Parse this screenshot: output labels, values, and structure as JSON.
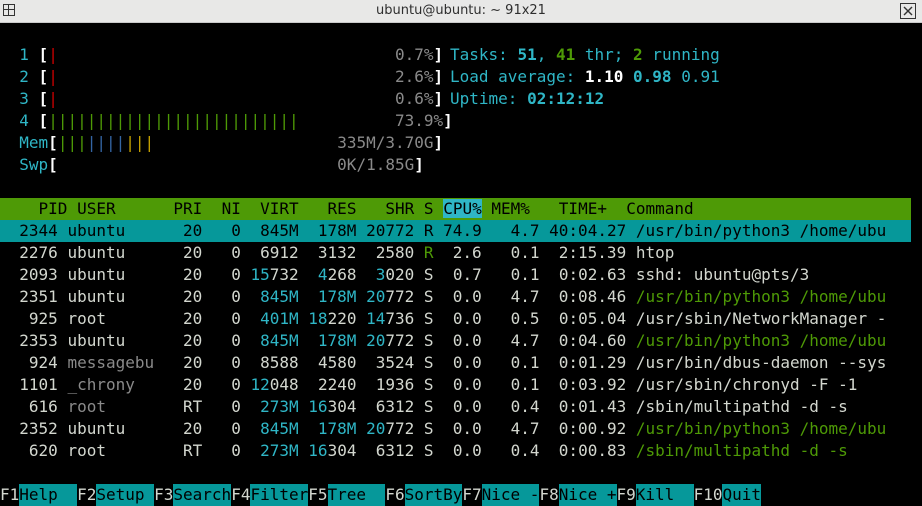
{
  "window": {
    "title": "ubuntu@ubuntu: ~ 91x21"
  },
  "meters": {
    "cpus": [
      {
        "id": "1",
        "bar": "|",
        "pad": "                                   ",
        "value": "0.7%"
      },
      {
        "id": "2",
        "bar": "|",
        "pad": "                                   ",
        "value": "2.6%"
      },
      {
        "id": "3",
        "bar": "|",
        "pad": "                                   ",
        "value": "0.6%"
      },
      {
        "id": "4",
        "bar": "||||||||||||||||||||||||||",
        "pad": "          ",
        "value": "73.9%"
      }
    ],
    "mem": {
      "label": "Mem",
      "bar": "||||||||||",
      "pad": "                   ",
      "value": "335M/3.70G"
    },
    "swp": {
      "label": "Swp",
      "pad": "                             ",
      "value": "0K/1.85G"
    }
  },
  "summary": {
    "tasks_label": "Tasks: ",
    "tasks": "51",
    "thr": "41",
    "thr_label": " thr; ",
    "running": "2",
    "running_label": " running",
    "load_label": "Load average: ",
    "load1": "1.10",
    "load5": "0.98",
    "load15": "0.91",
    "uptime_label": "Uptime: ",
    "uptime": "02:12:12"
  },
  "table": {
    "headers": {
      "pid": "  PID",
      "user": "USER",
      "pri": "PRI",
      "ni": "NI",
      "virt": "VIRT",
      "res": "RES",
      "shr": "SHR",
      "s": "S",
      "cpu": "CPU%",
      "mem": "MEM%",
      "time": "TIME+",
      "command": "Command"
    },
    "rows": [
      {
        "pid": "2344",
        "user": "ubuntu",
        "pri": "20",
        "ni": "0",
        "virt": "845M",
        "res": "178M",
        "shr_hi": "20",
        "shr_lo": "772",
        "s": "R",
        "cpu": "74.9",
        "mem": "4.7",
        "time": "40:04.27",
        "command": "/usr/bin/python3 /home/ubu",
        "selected": true
      },
      {
        "pid": "2276",
        "user": "ubuntu",
        "pri": "20",
        "ni": "0",
        "virt": "6912",
        "res": "3132",
        "shr_hi": "",
        "shr_lo": "2580",
        "s": "R",
        "cpu": "2.6",
        "mem": "0.1",
        "time": "2:15.39",
        "command": "htop"
      },
      {
        "pid": "2093",
        "user": "ubuntu",
        "pri": "20",
        "ni": "0",
        "virt_hi": "15",
        "virt": "732",
        "res_hi": "4",
        "res": "268",
        "shr_hi": "3",
        "shr_lo": "020",
        "s": "S",
        "cpu": "0.7",
        "mem": "0.1",
        "time": "0:02.63",
        "command": "sshd: ubuntu@pts/3"
      },
      {
        "pid": "2351",
        "user": "ubuntu",
        "pri": "20",
        "ni": "0",
        "virt": "845M",
        "res": "178M",
        "shr_hi": "20",
        "shr_lo": "772",
        "s": "S",
        "cpu": "0.0",
        "mem": "4.7",
        "time": "0:08.46",
        "command": "/usr/bin/python3 /home/ubu",
        "thread": true
      },
      {
        "pid": "925",
        "user": "root",
        "pri": "20",
        "ni": "0",
        "virt": "401M",
        "res_hi": "18",
        "res": "220",
        "shr_hi": "14",
        "shr_lo": "736",
        "s": "S",
        "cpu": "0.0",
        "mem": "0.5",
        "time": "0:05.04",
        "command": "/usr/sbin/NetworkManager -"
      },
      {
        "pid": "2353",
        "user": "ubuntu",
        "pri": "20",
        "ni": "0",
        "virt": "845M",
        "res": "178M",
        "shr_hi": "20",
        "shr_lo": "772",
        "s": "S",
        "cpu": "0.0",
        "mem": "4.7",
        "time": "0:04.60",
        "command": "/usr/bin/python3 /home/ubu",
        "thread": true
      },
      {
        "pid": "924",
        "user": "messagebu",
        "pri": "20",
        "ni": "0",
        "virt": "8588",
        "res": "4580",
        "shr_hi": "",
        "shr_lo": "3524",
        "s": "S",
        "cpu": "0.0",
        "mem": "0.1",
        "time": "0:01.29",
        "command": "/usr/bin/dbus-daemon --sys"
      },
      {
        "pid": "1101",
        "user": "_chrony",
        "pri": "20",
        "ni": "0",
        "virt_hi": "12",
        "virt": "048",
        "res": "2240",
        "shr_hi": "",
        "shr_lo": "1936",
        "s": "S",
        "cpu": "0.0",
        "mem": "0.1",
        "time": "0:03.92",
        "command": "/usr/sbin/chronyd -F -1"
      },
      {
        "pid": "616",
        "user": "root",
        "pri": "RT",
        "ni": "0",
        "virt": "273M",
        "res_hi": "16",
        "res": "304",
        "shr_hi": "",
        "shr_lo": "6312",
        "s": "S",
        "cpu": "0.0",
        "mem": "0.4",
        "time": "0:01.43",
        "command": "/sbin/multipathd -d -s"
      },
      {
        "pid": "2352",
        "user": "ubuntu",
        "pri": "20",
        "ni": "0",
        "virt": "845M",
        "res": "178M",
        "shr_hi": "20",
        "shr_lo": "772",
        "s": "S",
        "cpu": "0.0",
        "mem": "4.7",
        "time": "0:00.92",
        "command": "/usr/bin/python3 /home/ubu",
        "thread": true
      },
      {
        "pid": "620",
        "user": "root",
        "pri": "RT",
        "ni": "0",
        "virt": "273M",
        "res_hi": "16",
        "res": "304",
        "shr_hi": "",
        "shr_lo": "6312",
        "s": "S",
        "cpu": "0.0",
        "mem": "0.4",
        "time": "0:00.83",
        "command": "/sbin/multipathd -d -s",
        "thread": true
      }
    ]
  },
  "function_keys": [
    {
      "key": "F1",
      "label": "Help  "
    },
    {
      "key": "F2",
      "label": "Setup "
    },
    {
      "key": "F3",
      "label": "Search"
    },
    {
      "key": "F4",
      "label": "Filter"
    },
    {
      "key": "F5",
      "label": "Tree  "
    },
    {
      "key": "F6",
      "label": "SortBy"
    },
    {
      "key": "F7",
      "label": "Nice -"
    },
    {
      "key": "F8",
      "label": "Nice +"
    },
    {
      "key": "F9",
      "label": "Kill  "
    },
    {
      "key": "F10",
      "label": "Quit"
    }
  ],
  "colors": {
    "header_bg": "#4e9a06",
    "selected_bg": "#06989a",
    "cyan": "#2fb6c6",
    "green": "#4e9a06"
  },
  "icons": {
    "menu": "terminal-menu-icon",
    "close": "close-icon"
  }
}
